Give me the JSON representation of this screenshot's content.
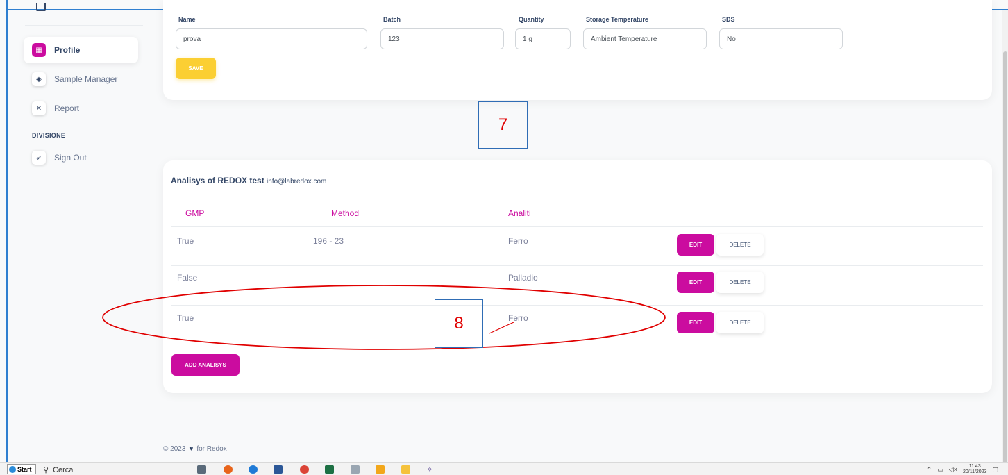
{
  "sidebar": {
    "items": [
      {
        "label": "Profile",
        "icon": "store-icon",
        "active": true
      },
      {
        "label": "Sample Manager",
        "icon": "box-icon",
        "active": false
      },
      {
        "label": "Report",
        "icon": "tools-icon",
        "active": false
      }
    ],
    "section_label": "DIVISIONE",
    "signout": {
      "label": "Sign Out",
      "icon": "rocket-icon"
    }
  },
  "sample_form": {
    "fields": [
      {
        "label": "Name",
        "value": "prova"
      },
      {
        "label": "Batch",
        "value": "123"
      },
      {
        "label": "Quantity",
        "value": "1 g"
      },
      {
        "label": "Storage Temperature",
        "value": "Ambient Temperature"
      },
      {
        "label": "SDS",
        "value": "No"
      }
    ],
    "save_label": "SAVE"
  },
  "annotations": [
    "7",
    "8"
  ],
  "analysis": {
    "title": "Analisys of REDOX test",
    "email": "info@labredox.com",
    "columns": [
      "GMP",
      "Method",
      "Analiti"
    ],
    "rows": [
      {
        "gmp": "True",
        "method": "196 - 23",
        "analiti": "Ferro"
      },
      {
        "gmp": "False",
        "method": "",
        "analiti": "Palladio"
      },
      {
        "gmp": "True",
        "method": "",
        "analiti": "Ferro"
      }
    ],
    "edit_label": "EDIT",
    "delete_label": "DELETE",
    "add_label": "ADD ANALISYS"
  },
  "footer": {
    "year": "© 2023",
    "text": "for Redox"
  },
  "taskbar": {
    "start_label": "Start",
    "search_label": "Cerca",
    "time": "11:43",
    "date": "20/11/2023"
  },
  "colors": {
    "accent": "#cb0c9f",
    "save": "#fbcf33",
    "annotation_red": "#e00000",
    "annotation_box": "#2f6db5"
  }
}
